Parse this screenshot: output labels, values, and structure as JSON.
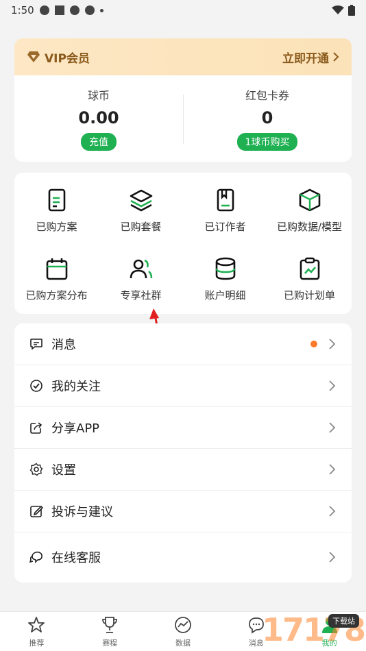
{
  "status_bar": {
    "time": "1:50"
  },
  "vip": {
    "title": "VIP会员",
    "open_label": "立即开通",
    "coins_label": "球币",
    "coins_value": "0.00",
    "recharge_label": "充值",
    "coupons_label": "红包卡券",
    "coupons_value": "0",
    "buy_label": "1球币购买",
    "accent": "#1fb052"
  },
  "grid": {
    "items": [
      {
        "label": "已购方案",
        "icon": "document-icon"
      },
      {
        "label": "已购套餐",
        "icon": "layers-icon"
      },
      {
        "label": "已订作者",
        "icon": "bookmark-book-icon"
      },
      {
        "label": "已购数据/模型",
        "icon": "cube-icon"
      },
      {
        "label": "已购方案分布",
        "icon": "calendar-icon"
      },
      {
        "label": "专享社群",
        "icon": "users-icon"
      },
      {
        "label": "账户明细",
        "icon": "database-icon"
      },
      {
        "label": "已购计划单",
        "icon": "clipboard-chart-icon"
      }
    ]
  },
  "list": {
    "items": [
      {
        "label": "消息",
        "icon": "message-icon",
        "badge": true
      },
      {
        "label": "我的关注",
        "icon": "check-badge-icon",
        "badge": false
      },
      {
        "label": "分享APP",
        "icon": "share-icon",
        "badge": false
      },
      {
        "label": "设置",
        "icon": "settings-icon",
        "badge": false
      },
      {
        "label": "投诉与建议",
        "icon": "edit-icon",
        "badge": false
      },
      {
        "label": "在线客服",
        "icon": "chat-icon",
        "badge": false
      }
    ]
  },
  "tabbar": {
    "tabs": [
      {
        "label": "推荐",
        "icon": "star-icon"
      },
      {
        "label": "赛程",
        "icon": "trophy-icon"
      },
      {
        "label": "数据",
        "icon": "trend-icon"
      },
      {
        "label": "消息",
        "icon": "chat-bubble-icon"
      },
      {
        "label": "我的",
        "icon": "user-icon"
      }
    ]
  },
  "watermark": {
    "text": "17178",
    "badge": "下载站"
  }
}
